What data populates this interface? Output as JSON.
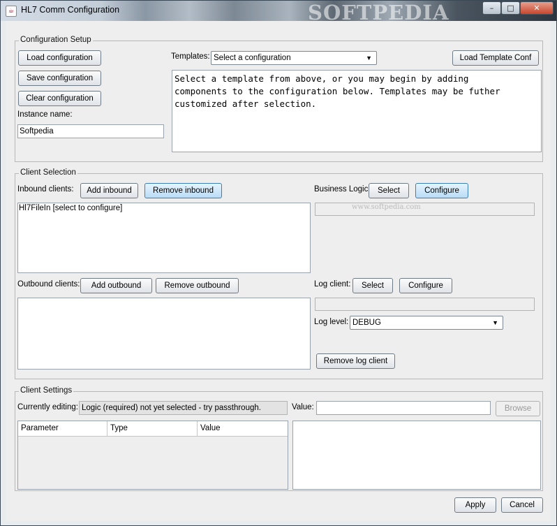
{
  "window": {
    "title": "HL7 Comm Configuration",
    "watermark": "SOFTPEDIA",
    "controls": {
      "minimize": "–",
      "maximize": "□",
      "close": "✕"
    }
  },
  "config_setup": {
    "group_title": "Configuration Setup",
    "load_label": "Load configuration",
    "save_label": "Save configuration",
    "clear_label": "Clear configuration",
    "instance_label": "Instance name:",
    "instance_value": "Softpedia",
    "templates_label": "Templates:",
    "templates_selected": "Select a configuration",
    "load_template_label": "Load Template Conf",
    "description": "Select a template from above, or you may begin by adding\ncomponents to the configuration below. Templates may be futher\ncustomized after selection."
  },
  "client_selection": {
    "group_title": "Client Selection",
    "inbound_label": "Inbound clients:",
    "add_inbound": "Add inbound",
    "remove_inbound": "Remove inbound",
    "inbound_items": [
      "Hl7FileIn [select to configure]"
    ],
    "outbound_label": "Outbound clients:",
    "add_outbound": "Add outbound",
    "remove_outbound": "Remove outbound",
    "business_logic_label": "Business Logic:",
    "bl_select": "Select",
    "bl_configure": "Configure",
    "bl_watermark": "www.softpedia.com",
    "log_client_label": "Log client:",
    "lc_select": "Select",
    "lc_configure": "Configure",
    "log_level_label": "Log level:",
    "log_level_value": "DEBUG",
    "remove_log_client": "Remove log client"
  },
  "client_settings": {
    "group_title": "Client Settings",
    "editing_label": "Currently editing:",
    "editing_value": "Logic (required) not yet selected - try passthrough.",
    "value_label": "Value:",
    "value_input": "",
    "browse_label": "Browse",
    "columns": [
      "Parameter",
      "Type",
      "Value"
    ]
  },
  "footer": {
    "apply_label": "Apply",
    "cancel_label": "Cancel"
  }
}
